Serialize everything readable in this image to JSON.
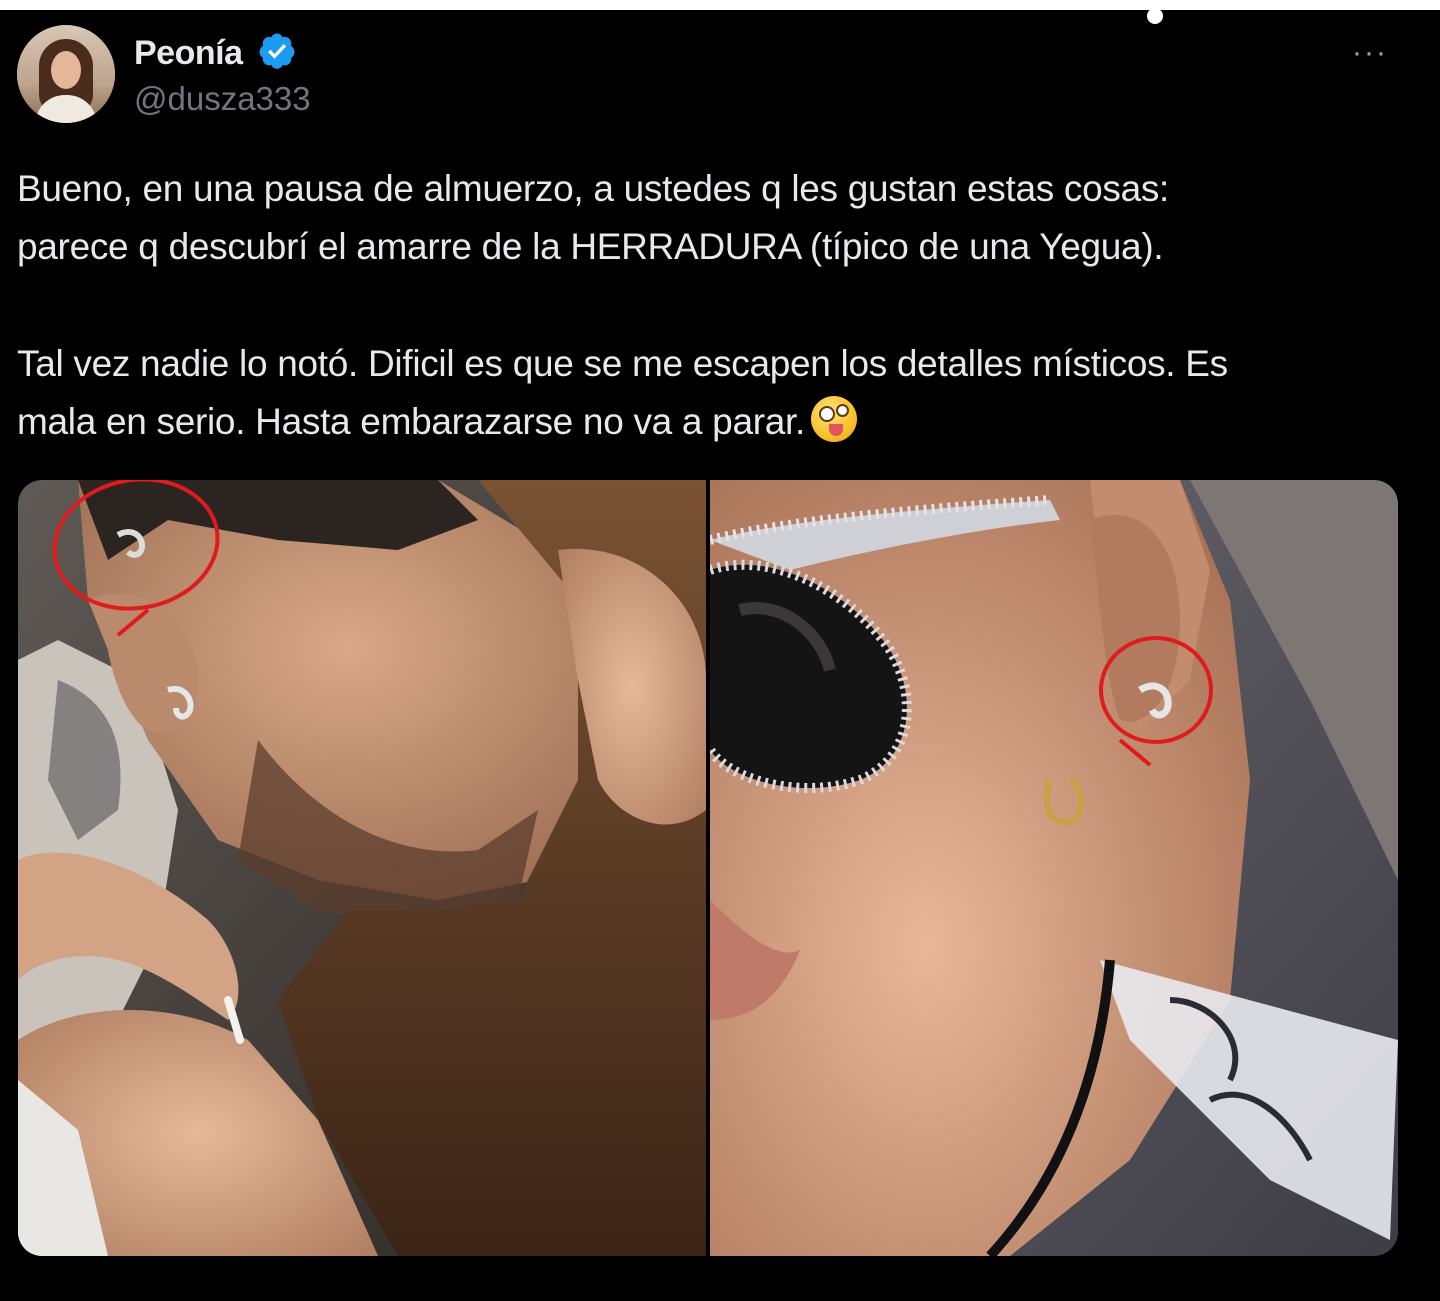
{
  "tweet": {
    "display_name": "Peonía",
    "handle": "@dusza333",
    "verified": true,
    "more_label": "···",
    "paragraph_1_line_1": "Bueno, en una pausa de almuerzo, a ustedes q les gustan estas cosas:",
    "paragraph_1_line_2": "parece q descubrí el amarre de la HERRADURA (típico de una Yegua).",
    "paragraph_2_line_1": "Tal vez nadie lo notó. Dificil es que se me escapen los detalles místicos. Es",
    "paragraph_2_line_2": "mala en serio. Hasta embarazarse no va a parar.",
    "emoji": "zany-face-icon"
  },
  "media": {
    "count": 2
  },
  "colors": {
    "background": "#000000",
    "text": "#e7e9ea",
    "secondary": "#71767b",
    "verified": "#1d9bf0",
    "annotation": "#e01b1b"
  }
}
